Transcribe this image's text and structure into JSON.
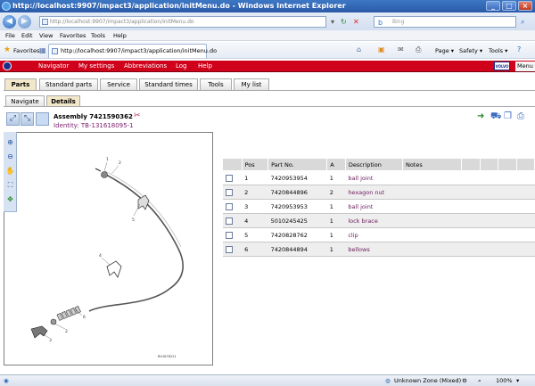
{
  "window": {
    "title": "http://localhost:9907/impact3/application/initMenu.do - Windows Internet Explorer",
    "buttons": [
      "_",
      "□",
      "×"
    ]
  },
  "address_bar": {
    "url": "http://localhost:9907/impact3/application/initMenu.do",
    "search_placeholder": "Bing"
  },
  "menu_bar": [
    "File",
    "Edit",
    "View",
    "Favorites",
    "Tools",
    "Help"
  ],
  "favorites_bar": {
    "favorites_label": "Favorites",
    "tab_title": "http://localhost:9907/impact3/application/initMenu.do",
    "commands": [
      "Page ▾",
      "Safety ▾",
      "Tools ▾"
    ]
  },
  "app_nav": {
    "items": [
      "Navigator",
      "My settings",
      "Abbreviations",
      "Log",
      "Help"
    ],
    "brand": "VOLVO",
    "right_menu": "Menu"
  },
  "main_tabs": [
    "Parts",
    "Standard parts",
    "Service",
    "Standard times",
    "Tools",
    "My list"
  ],
  "sub_tabs": [
    "Navigate",
    "Details"
  ],
  "assembly": {
    "title": "Assembly 7421590362",
    "identity": "Identity: TB-131618095-1"
  },
  "drawing": {
    "caption": "RH1876221",
    "callouts": [
      "1",
      "2",
      "3",
      "4",
      "5",
      "6"
    ]
  },
  "table": {
    "headers": [
      "",
      "Pos",
      "Part No.",
      "A",
      "Description",
      "Notes",
      "",
      "",
      "",
      ""
    ],
    "rows": [
      {
        "pos": "1",
        "part_no": "7420953954",
        "a": "1",
        "description": "ball joint"
      },
      {
        "pos": "2",
        "part_no": "7420844896",
        "a": "2",
        "description": "hexagon nut"
      },
      {
        "pos": "3",
        "part_no": "7420953953",
        "a": "1",
        "description": "ball joint"
      },
      {
        "pos": "4",
        "part_no": "5010245425",
        "a": "1",
        "description": "lock brace"
      },
      {
        "pos": "5",
        "part_no": "7420828762",
        "a": "1",
        "description": "clip"
      },
      {
        "pos": "6",
        "part_no": "7420844894",
        "a": "1",
        "description": "bellows"
      }
    ]
  },
  "status_bar": {
    "zone": "Unknown Zone (Mixed)",
    "zoom": "100%"
  }
}
